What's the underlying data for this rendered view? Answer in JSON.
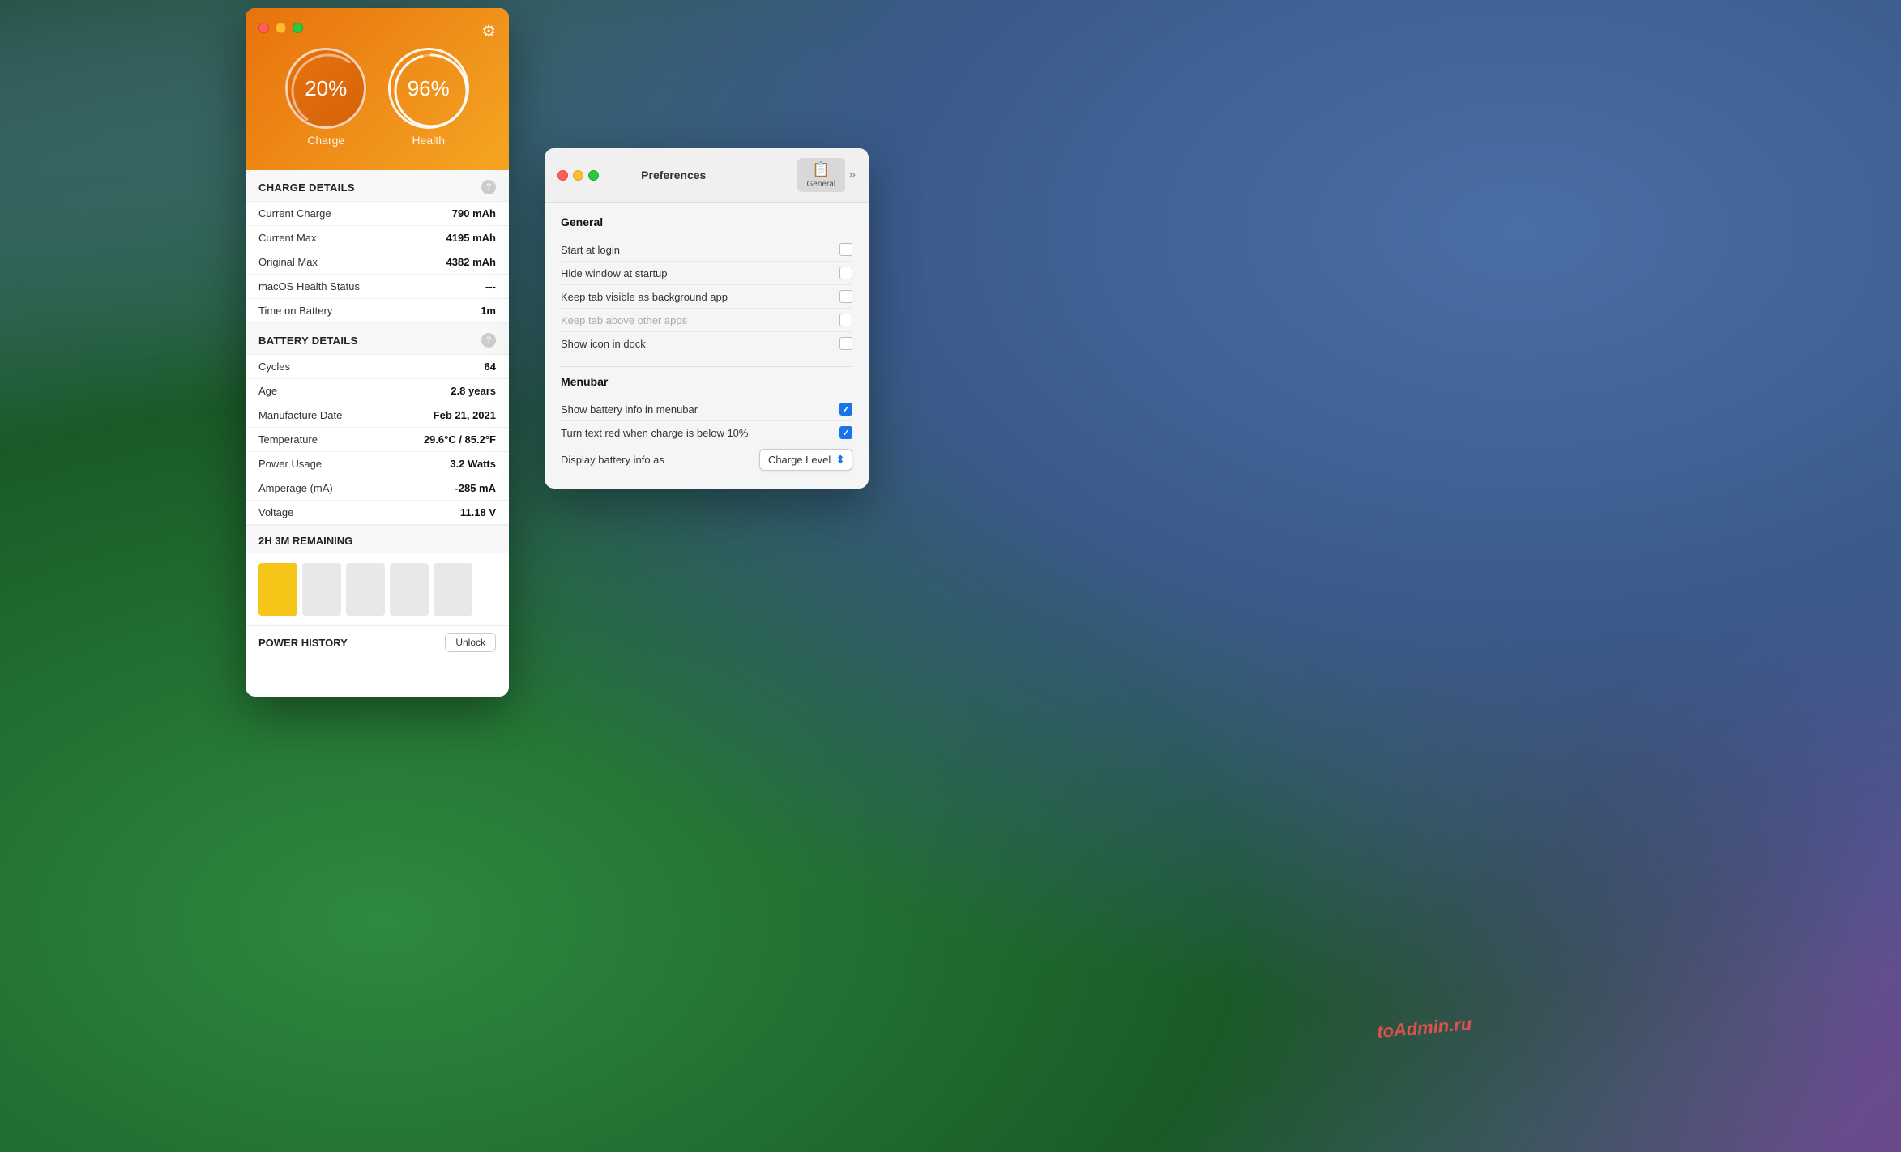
{
  "wallpaper": {
    "description": "macOS Sonoma wallpaper gradient"
  },
  "battery_window": {
    "traffic_lights": [
      "red",
      "yellow",
      "green"
    ],
    "gear_label": "⚙",
    "charge_value": "20%",
    "charge_label": "Charge",
    "health_value": "96%",
    "health_label": "Health",
    "charge_details_title": "CHARGE DETAILS",
    "battery_details_title": "BATTERY DETAILS",
    "details": [
      {
        "label": "Current Charge",
        "value": "790 mAh"
      },
      {
        "label": "Current Max",
        "value": "4195 mAh"
      },
      {
        "label": "Original Max",
        "value": "4382 mAh"
      },
      {
        "label": "macOS Health Status",
        "value": "---"
      },
      {
        "label": "Time on Battery",
        "value": "1m"
      }
    ],
    "battery_details": [
      {
        "label": "Cycles",
        "value": "64"
      },
      {
        "label": "Age",
        "value": "2.8 years"
      },
      {
        "label": "Manufacture Date",
        "value": "Feb 21, 2021"
      },
      {
        "label": "Temperature",
        "value": "29.6°C / 85.2°F"
      },
      {
        "label": "Power Usage",
        "value": "3.2 Watts"
      },
      {
        "label": "Amperage (mA)",
        "value": "-285 mA"
      },
      {
        "label": "Voltage",
        "value": "11.18 V"
      }
    ],
    "remaining_label": "2H 3M REMAINING",
    "power_history_label": "POWER HISTORY",
    "unlock_button": "Unlock"
  },
  "prefs_window": {
    "title": "Preferences",
    "toolbar": {
      "general_tab_icon": "🗂",
      "general_tab_label": "General",
      "chevron": "»"
    },
    "general_section_title": "General",
    "general_items": [
      {
        "label": "Start at login",
        "checked": false,
        "disabled": false
      },
      {
        "label": "Hide window at startup",
        "checked": false,
        "disabled": false
      },
      {
        "label": "Keep tab visible as background app",
        "checked": false,
        "disabled": false
      },
      {
        "label": "Keep tab above other apps",
        "checked": false,
        "disabled": true
      },
      {
        "label": "Show icon in dock",
        "checked": false,
        "disabled": false
      }
    ],
    "menubar_section_title": "Menubar",
    "menubar_items": [
      {
        "label": "Show battery info in menubar",
        "checked": true,
        "disabled": false
      },
      {
        "label": "Turn text red when charge is below 10%",
        "checked": true,
        "disabled": false
      }
    ],
    "display_row": {
      "label": "Display battery info as",
      "dropdown_value": "Charge Level"
    }
  },
  "watermark": {
    "text": "toAdmin.ru"
  }
}
